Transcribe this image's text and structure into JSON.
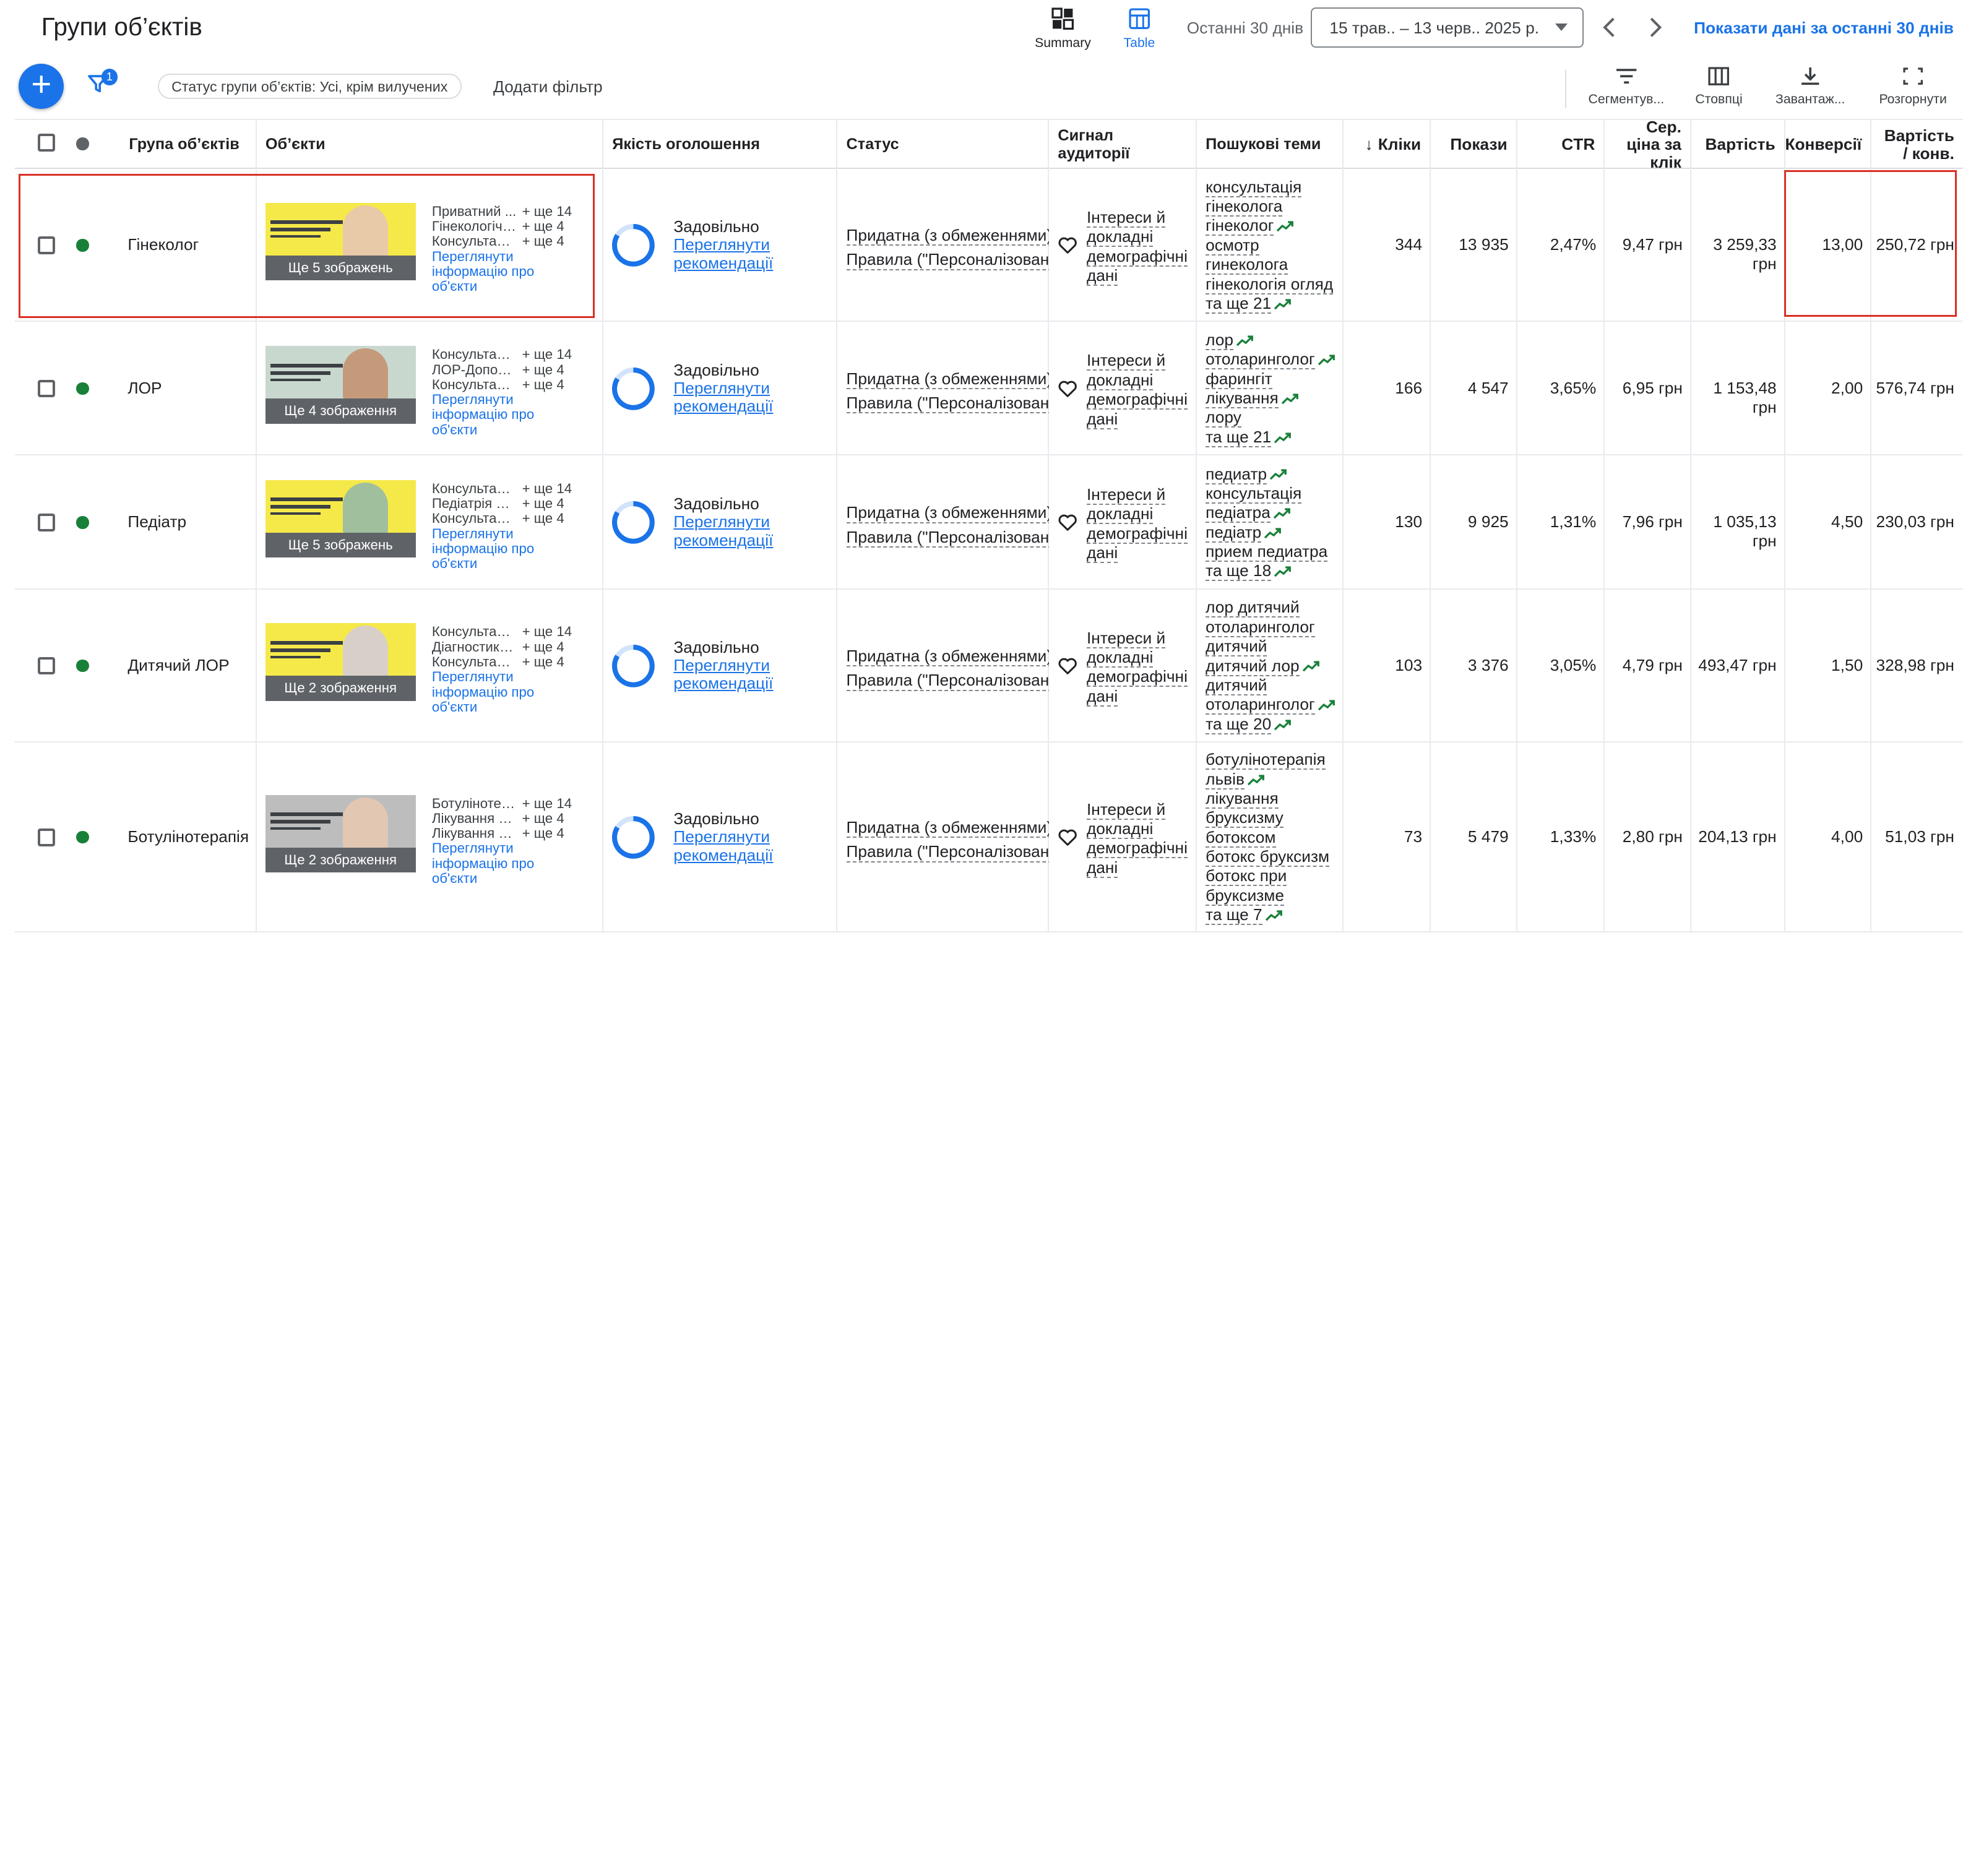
{
  "header": {
    "title": "Групи об’єктів",
    "views": [
      {
        "label": "Summary"
      },
      {
        "label": "Table"
      }
    ],
    "period_label": "Останні 30 днів",
    "date_range": "15 трав.. – 13 черв.. 2025 р.",
    "show_link": "Показати дані за останні 30 днів"
  },
  "toolbar": {
    "filter_count": "1",
    "chip": "Статус групи об’єктів: Усі, крім вилучених",
    "add_filter": "Додати фільтр",
    "tools": [
      "Сегментув...",
      "Стовпці",
      "Завантаж...",
      "Розгорнути"
    ]
  },
  "columns": {
    "group": "Група об’єктів",
    "assets": "Об’єкти",
    "quality": "Якість оголошення",
    "status": "Статус",
    "audience": "Сигнал аудиторії",
    "topics": "Пошукові теми",
    "clicks": "Кліки",
    "impr": "Покази",
    "ctr": "CTR",
    "cpc": "Сер. ціна за клік",
    "cost": "Вартість",
    "conv": "Конверсії",
    "cpa": "Вартість / конв."
  },
  "common": {
    "quality": "Задовільно",
    "quality_link1": "Переглянути",
    "quality_link2": "рекомендації",
    "status1": "Придатна (з обмеженнями)",
    "status2": "Правила (\"Персоналізована",
    "audience": [
      "Інтереси й",
      "докладні",
      "демографічні",
      "дані"
    ],
    "view_info": [
      "Переглянути",
      "інформацію про",
      "об'єкти"
    ]
  },
  "rows": [
    {
      "name": "Гінеколог",
      "thumb_label": "Ще 5 зображень",
      "assets": [
        [
          "Приватний ...",
          "+ ще 14"
        ],
        [
          "Гінекологічн...",
          "+ ще 4"
        ],
        [
          "Консультація...",
          "+ ще 4"
        ]
      ],
      "topics": [
        {
          "t": "консультація",
          "tr": false
        },
        {
          "t": "гінеколога",
          "tr": false
        },
        {
          "t": "гінеколог",
          "tr": true
        },
        {
          "t": "осмотр",
          "tr": false
        },
        {
          "t": "гинеколога",
          "tr": false
        },
        {
          "t": "гінекологія огляд",
          "tr": false
        },
        {
          "t": "та ще 21",
          "tr": true
        }
      ],
      "clicks": "344",
      "impr": "13 935",
      "ctr": "2,47%",
      "cpc": "9,47 грн",
      "cost": "3 259,33 грн",
      "conv": "13,00",
      "cpa": "250,72 грн"
    },
    {
      "name": "ЛОР",
      "thumb_label": "Ще 4 зображення",
      "assets": [
        [
          "Консультаці...",
          "+ ще 14"
        ],
        [
          "ЛОР-Допомо...",
          "+ ще 4"
        ],
        [
          "Консультація...",
          "+ ще 4"
        ]
      ],
      "topics": [
        {
          "t": "лор",
          "tr": true
        },
        {
          "t": "отоларинголог",
          "tr": true
        },
        {
          "t": "фарингіт",
          "tr": false
        },
        {
          "t": "лікування",
          "tr": true
        },
        {
          "t": "лору",
          "tr": false
        },
        {
          "t": "та ще 21",
          "tr": true
        }
      ],
      "clicks": "166",
      "impr": "4 547",
      "ctr": "3,65%",
      "cpc": "6,95 грн",
      "cost": "1 153,48 грн",
      "conv": "2,00",
      "cpa": "576,74 грн"
    },
    {
      "name": "Педіатр",
      "thumb_label": "Ще 5 зображень",
      "assets": [
        [
          "Консультаці...",
          "+ ще 14"
        ],
        [
          "Педіатрія що...",
          "+ ще 4"
        ],
        [
          "Консультація...",
          "+ ще 4"
        ]
      ],
      "topics": [
        {
          "t": "педиатр",
          "tr": true
        },
        {
          "t": "консультація",
          "tr": false
        },
        {
          "t": "педіатра",
          "tr": true
        },
        {
          "t": "педіатр",
          "tr": true
        },
        {
          "t": "прием педиатра",
          "tr": false
        },
        {
          "t": "та ще 18",
          "tr": true
        }
      ],
      "clicks": "130",
      "impr": "9 925",
      "ctr": "1,31%",
      "cpc": "7,96 грн",
      "cost": "1 035,13 грн",
      "conv": "4,50",
      "cpa": "230,03 грн"
    },
    {
      "name": "Дитячий ЛОР",
      "thumb_label": "Ще 2 зображення",
      "assets": [
        [
          "Консультаці...",
          "+ ще 14"
        ],
        [
          "Діагностика ...",
          "+ ще 4"
        ],
        [
          "Консультація...",
          "+ ще 4"
        ]
      ],
      "topics": [
        {
          "t": "лор дитячий",
          "tr": false
        },
        {
          "t": "отоларинголог",
          "tr": false
        },
        {
          "t": "дитячий",
          "tr": false
        },
        {
          "t": "дитячий лор",
          "tr": true
        },
        {
          "t": "дитячий",
          "tr": false
        },
        {
          "t": "отоларинголог",
          "tr": true
        },
        {
          "t": "та ще 20",
          "tr": true
        }
      ],
      "clicks": "103",
      "impr": "3 376",
      "ctr": "3,05%",
      "cpc": "4,79 грн",
      "cost": "493,47 грн",
      "conv": "1,50",
      "cpa": "328,98 грн"
    },
    {
      "name": "Ботулінотерапія",
      "thumb_label": "Ще 2 зображення",
      "assets": [
        [
          "Ботулінотер...",
          "+ ще 14"
        ],
        [
          "Лікування Бо...",
          "+ ще 4"
        ],
        [
          "Лікування Мі...",
          "+ ще 4"
        ]
      ],
      "topics": [
        {
          "t": "ботулінотерапія",
          "tr": false
        },
        {
          "t": "львів",
          "tr": true
        },
        {
          "t": "лікування",
          "tr": false
        },
        {
          "t": "бруксизму",
          "tr": false
        },
        {
          "t": "ботоксом",
          "tr": false
        },
        {
          "t": "ботокс бруксизм",
          "tr": false
        },
        {
          "t": "ботокс при",
          "tr": false
        },
        {
          "t": "бруксизме",
          "tr": false
        },
        {
          "t": "та ще 7",
          "tr": true
        }
      ],
      "clicks": "73",
      "impr": "5 479",
      "ctr": "1,33%",
      "cpc": "2,80 грн",
      "cost": "204,13 грн",
      "conv": "4,00",
      "cpa": "51,03 грн"
    }
  ],
  "colors": {
    "accent": "#1a73e8",
    "enabled": "#188038",
    "highlight": "#d93025",
    "trend": "#188038"
  }
}
